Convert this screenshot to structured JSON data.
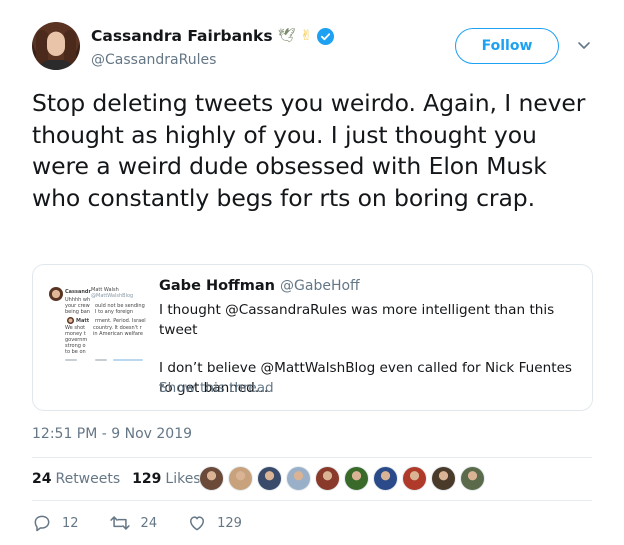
{
  "author": {
    "display_name": "Cassandra Fairbanks",
    "emojis": [
      "🕊",
      "✌"
    ],
    "handle": "@CassandraRules",
    "verified": true
  },
  "follow_button": {
    "label": "Follow"
  },
  "more_icon": "chevron-down-icon",
  "tweet": {
    "text": "Stop deleting tweets you weirdo. Again, I never thought as highly of you. I just thought you were a weird dude obsessed with Elon Musk who constantly begs for rts on boring crap."
  },
  "quoted_tweet": {
    "author_name": "Gabe Hoffman",
    "author_handle": "@GabeHoff",
    "paragraphs": [
      "I thought @CassandraRules was more intelligent than this tweet",
      "I don’t believe @MattWalshBlog even called for Nick Fuentes to get banned…"
    ],
    "show_thread": "Show this thread",
    "thumbnail_lines": [
      "Cassandr",
      "Uhhhh wh",
      "your crew",
      "being ban",
      "Matt",
      "We shot",
      "money t",
      "governm",
      "strong o",
      "to be on"
    ],
    "thumbnail_lines_right": [
      "Matt Walsh",
      "@MattWalshBlog",
      "ould not be sending",
      "I to any foreign",
      "rment. Period. Israel",
      "country. It doesn't r",
      "in American welfare"
    ]
  },
  "timestamp": "12:51 PM - 9 Nov 2019",
  "stats": {
    "retweets_count": "24",
    "retweets_label": "Retweets",
    "likes_count": "129",
    "likes_label": "Likes"
  },
  "liker_avatars": [
    "#6b4a3a",
    "#c8a27c",
    "#3a4a6a",
    "#9ab0c8",
    "#8a3a2a",
    "#3a6a2a",
    "#2a4a8a",
    "#b03a2a",
    "#4a3a2a",
    "#5a6a4a"
  ],
  "actions": {
    "reply_count": "12",
    "retweet_count": "24",
    "like_count": "129"
  },
  "colors": {
    "accent": "#1da1f2",
    "secondary_text": "#657786",
    "border": "#e1e8ed"
  }
}
